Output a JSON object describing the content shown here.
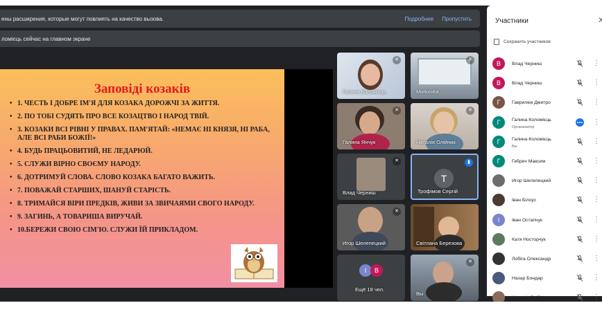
{
  "banner": {
    "text": "ены расширения, которые могут повлиять на качество вызова.",
    "details_link": "Подробнее",
    "skip_link": "Пропустить"
  },
  "presenting_banner": {
    "text": "ломієць сейчас на главном экране"
  },
  "slide": {
    "title": "Заповіді козаків",
    "items": [
      "1. ЧЕСТЬ І ДОБРЕ ІМ'Я ДЛЯ КОЗАКА ДОРОЖЧІ ЗА ЖИТТЯ.",
      "2. ПО ТОБІ СУДЯТЬ ПРО ВСЕ КОЗАЦТВО І НАРОД ТВІЙ.",
      "3. КОЗАКИ ВСІ РІВНІ У ПРАВАХ. ПАМ'ЯТАЙ: «НЕМАЄ НІ КНЯЗЯ, НІ РАБА, АЛЕ ВСІ РАБИ БОЖІЇ!»",
      "4. БУДЬ ПРАЦЬОВИТИЙ, НЕ ЛЕДАРЮЙ.",
      "5. СЛУЖИ ВІРНО СВОЄМУ НАРОДУ.",
      "6. ДОТРИМУЙ СЛОВА. СЛОВО КОЗАКА БАГАТО ВАЖИТЬ.",
      "7. ПОВАЖАЙ СТАРШИХ, ШАНУЙ СТАРІСТЬ.",
      "8. ТРИМАЙСЯ ВІРИ ПРЕДКІВ, ЖИВИ ЗА ЗВИЧАЯМИ СВОГО НАРОДУ.",
      "9. ЗАГИНЬ, А ТОВАРИША ВИРУЧАЙ.",
      "10.БЕРЕЖИ СВОЮ СІМ'Ю. СЛУЖИ ЇЙ ПРИКЛАДОМ."
    ]
  },
  "tiles": [
    {
      "name": "Галина Коломієць"
    },
    {
      "name": "Morkovka"
    },
    {
      "name": "Галина Янчук"
    },
    {
      "name": "Наталія Олійник"
    },
    {
      "name": "Влад Черниш"
    },
    {
      "name": "Трофімов Сергій",
      "initial": "T"
    },
    {
      "name": "Игор Шелепецкий"
    },
    {
      "name": "Світлана Березова"
    },
    {
      "name": "Ещё 18 чел.",
      "initials": [
        "I",
        "B"
      ]
    },
    {
      "name": "Вы"
    }
  ],
  "panel": {
    "title": "Участники",
    "close_icon": "close-icon",
    "save_label": "Сохранить участников",
    "participants": [
      {
        "name": "Влад Черниш",
        "initial": "B",
        "color": "#c2185b"
      },
      {
        "name": "Влад Черниш",
        "initial": "B",
        "color": "#c2185b"
      },
      {
        "name": "Гаврилюк Дмитро",
        "initial": "Г",
        "color": "#795548"
      },
      {
        "name": "Галина Коломієць",
        "role": "Организатор",
        "initial": "Г",
        "color": "#00897b"
      },
      {
        "name": "Галина Коломієць",
        "role": "Вы",
        "initial": "Г",
        "color": "#00897b"
      },
      {
        "name": "Гебрич Максим",
        "initial": "Г",
        "color": "#00897b"
      },
      {
        "name": "Игор Шелепецкий",
        "initial": "",
        "color": "#6d6d6d"
      },
      {
        "name": "Іван Білоус",
        "initial": "",
        "color": "#4a3b35"
      },
      {
        "name": "Іван Остапчук",
        "initial": "I",
        "color": "#7986cb"
      },
      {
        "name": "Катя Носторчук",
        "initial": "",
        "color": "#5d7a5e"
      },
      {
        "name": "Лобіга Олександр",
        "initial": "",
        "color": "#333333"
      },
      {
        "name": "Назар Бондар",
        "initial": "",
        "color": "#4a5a7a"
      },
      {
        "name": "Наталія Олійник",
        "initial": "",
        "color": "#8b6b5a"
      }
    ]
  }
}
